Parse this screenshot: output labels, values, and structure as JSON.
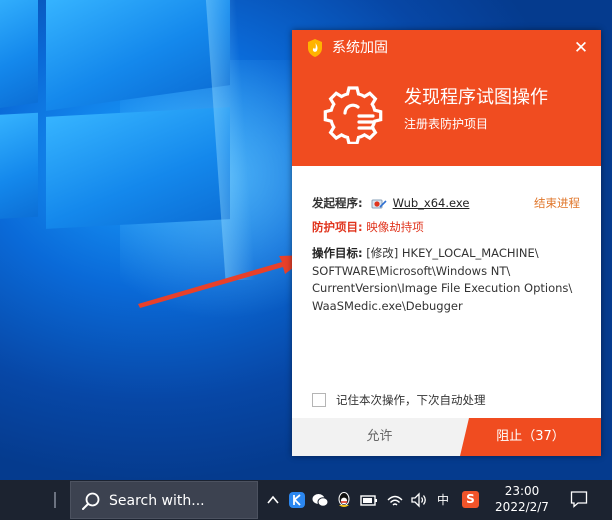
{
  "dialog": {
    "brand_title": "系统加固",
    "close_glyph": "✕",
    "alert_title": "发现程序试图操作",
    "alert_subtitle": "注册表防护项目",
    "initiator_label": "发起程序:",
    "initiator_file": "Wub_x64.exe",
    "end_process_label": "结束进程",
    "protect_label": "防护项目:",
    "protect_value": "映像劫持项",
    "target_label": "操作目标:",
    "target_value": "[修改] HKEY_LOCAL_MACHINE\\ SOFTWARE\\Microsoft\\Windows NT\\ CurrentVersion\\Image File Execution Options\\ WaaSMedic.exe\\Debugger",
    "remember_label": "记住本次操作，下次自动处理",
    "allow_label": "允许",
    "block_label": "阻止（37）",
    "accent_color": "#f04c20"
  },
  "taskbar": {
    "search_placeholder": "Search with...",
    "ime_label": "中",
    "sogou_badge": "S",
    "time": "23:00",
    "date": "2022/2/7",
    "tray_icons": [
      "chevron-up-icon",
      "kuaishou-icon",
      "wechat-icon",
      "qq-icon",
      "battery-icon",
      "wifi-icon",
      "volume-icon"
    ]
  }
}
